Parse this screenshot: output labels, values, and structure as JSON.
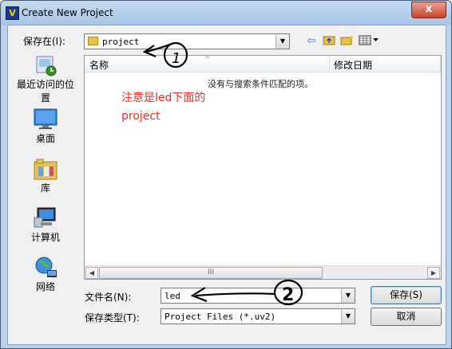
{
  "window": {
    "title": "Create New Project",
    "app_icon_glyph": "V",
    "close_glyph": "x"
  },
  "savein": {
    "label": "保存在(I):",
    "value": "project"
  },
  "toolbar": {
    "back_icon": "arrow-left-icon",
    "up_icon": "folder-up-icon",
    "new_folder_icon": "new-folder-icon",
    "view_icon": "view-menu-icon"
  },
  "places": [
    {
      "label": "最近访问的位置",
      "icon": "recent-places-icon"
    },
    {
      "label": "桌面",
      "icon": "desktop-icon"
    },
    {
      "label": "库",
      "icon": "libraries-icon"
    },
    {
      "label": "计算机",
      "icon": "computer-icon"
    },
    {
      "label": "网络",
      "icon": "network-icon"
    }
  ],
  "list": {
    "columns": [
      "名称",
      "修改日期"
    ],
    "empty_message": "没有与搜索条件匹配的项。",
    "scroll_grip": "III"
  },
  "annotation": {
    "line1": "注意是led下面的",
    "line2": "project",
    "marker1": "1",
    "marker2": "2",
    "color": "#e0302a"
  },
  "filename": {
    "label": "文件名(N):",
    "value": "led"
  },
  "filetype": {
    "label": "保存类型(T):",
    "value": "Project Files (*.uv2)"
  },
  "buttons": {
    "save": "保存(S)",
    "cancel": "取消"
  }
}
